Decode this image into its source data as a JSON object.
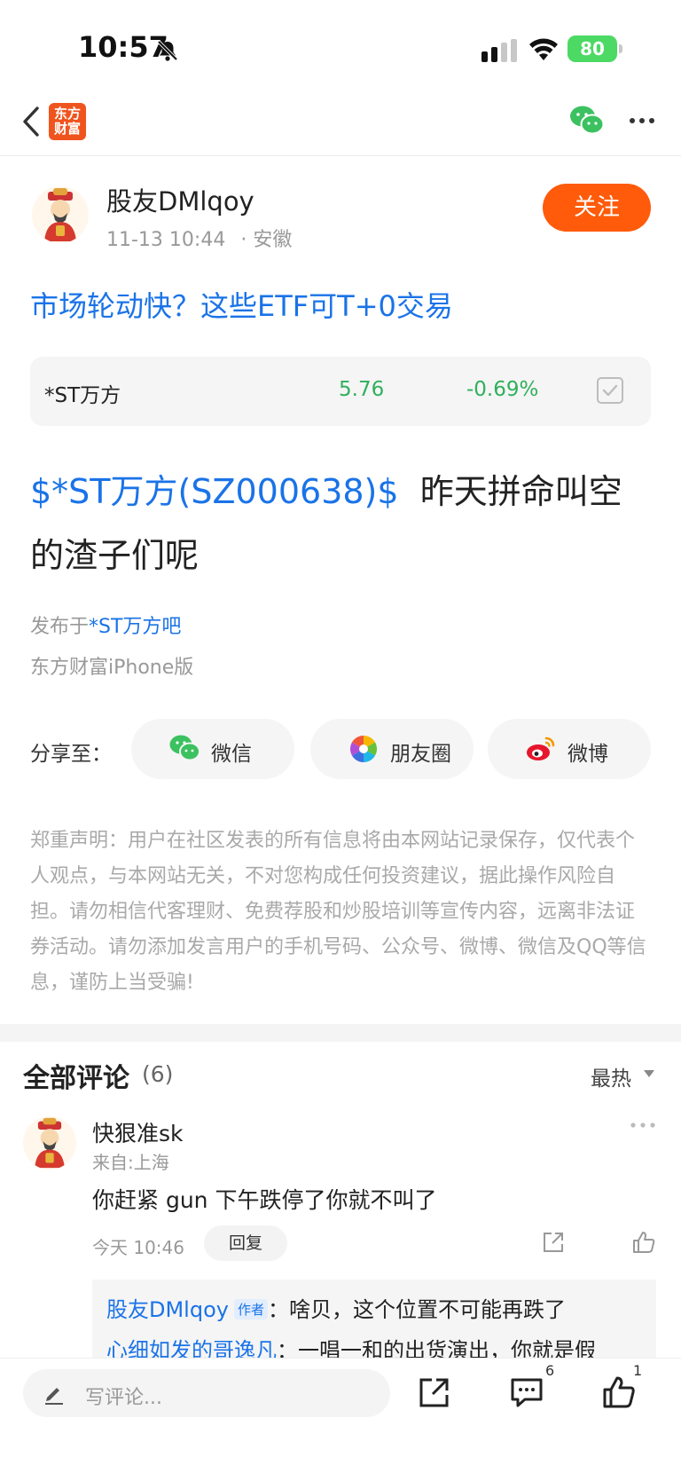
{
  "status_bar": {
    "time": "10:57",
    "battery": "80"
  },
  "nav": {
    "logo_line1": "东方",
    "logo_line2": "财富"
  },
  "post": {
    "author": "股友DMlqoy",
    "date": "11-13 10:44",
    "location": "· 安徽",
    "follow_label": "关注",
    "promo_title": "市场轮动快？这些ETF可T+0交易",
    "stock": {
      "name": "*ST万方",
      "price": "5.76",
      "change": "-0.69%"
    },
    "stock_tag": "$*ST万方(SZ000638)$",
    "content": "昨天拼命叫空的渣子们呢",
    "source_prefix": "发布于",
    "source_forum": "*ST万方吧",
    "client": "东方财富iPhone版"
  },
  "share": {
    "label": "分享至：",
    "wechat": "微信",
    "moments": "朋友圈",
    "weibo": "微博"
  },
  "disclaimer": "郑重声明：用户在社区发表的所有信息将由本网站记录保存，仅代表个人观点，与本网站无关，不对您构成任何投资建议，据此操作风险自担。请勿相信代客理财、免费荐股和炒股培训等宣传内容，远离非法证券活动。请勿添加发言用户的手机号码、公众号、微博、微信及QQ等信息，谨防上当受骗!",
  "comments": {
    "title": "全部评论",
    "count": "(6)",
    "sort": "最热",
    "items": [
      {
        "user": "快狠准sk",
        "from": "来自:上海",
        "text": "你赶紧 gun 下午跌停了你就不叫了",
        "time": "今天 10:46",
        "reply_label": "回复",
        "replies": [
          {
            "name": "股友DMlqoy",
            "badge": "作者",
            "sep": "：",
            "text": "啥贝，这个位置不可能再跌了"
          },
          {
            "name": "心细如发的哥逸凡",
            "sep": "：",
            "text": "一唱一和的出货演出，你就是假"
          }
        ]
      }
    ]
  },
  "bottom_bar": {
    "placeholder": "写评论...",
    "comment_count": "6",
    "like_count": "1"
  }
}
